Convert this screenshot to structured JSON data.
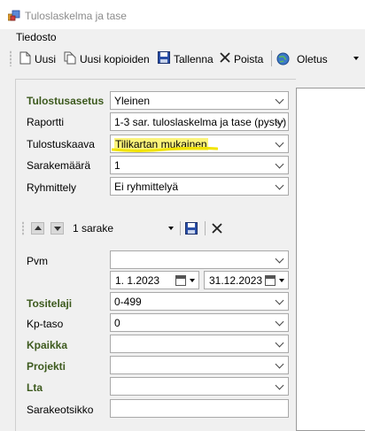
{
  "window": {
    "title": "Tuloslaskelma ja tase"
  },
  "menu": {
    "items": [
      {
        "label": "Tiedosto"
      }
    ]
  },
  "toolbar": {
    "new_label": "Uusi",
    "new_copy_label": "Uusi kopioiden",
    "save_label": "Tallenna",
    "delete_label": "Poista",
    "profile_value": "Oletus"
  },
  "settings": {
    "print_setting": {
      "label": "Tulostusasetus",
      "value": "Yleinen"
    },
    "report": {
      "label": "Raportti",
      "value": "1-3 sar. tuloslaskelma ja tase (pysty)"
    },
    "print_format": {
      "label": "Tulostuskaava",
      "value": "Tilikartan mukainen"
    },
    "column_count": {
      "label": "Sarakemäärä",
      "value": "1"
    },
    "grouping": {
      "label": "Ryhmittely",
      "value": "Ei ryhmittelyä"
    }
  },
  "column_editor": {
    "column_select": "1 sarake",
    "date": {
      "label": "Pvm",
      "value": ""
    },
    "date_from": "1.  1.2023",
    "date_to": "31.12.2023",
    "document_type": {
      "label": "Tositelaji",
      "value": "0-499"
    },
    "account_level": {
      "label": "Kp-taso",
      "value": "0"
    },
    "cost_center": {
      "label": "Kpaikka",
      "value": ""
    },
    "project": {
      "label": "Projekti",
      "value": ""
    },
    "lta": {
      "label": "Lta",
      "value": ""
    },
    "column_header": {
      "label": "Sarakeotsikko",
      "value": ""
    }
  },
  "colors": {
    "highlight": "#fbf37a",
    "label_green": "#3d5a1e"
  }
}
